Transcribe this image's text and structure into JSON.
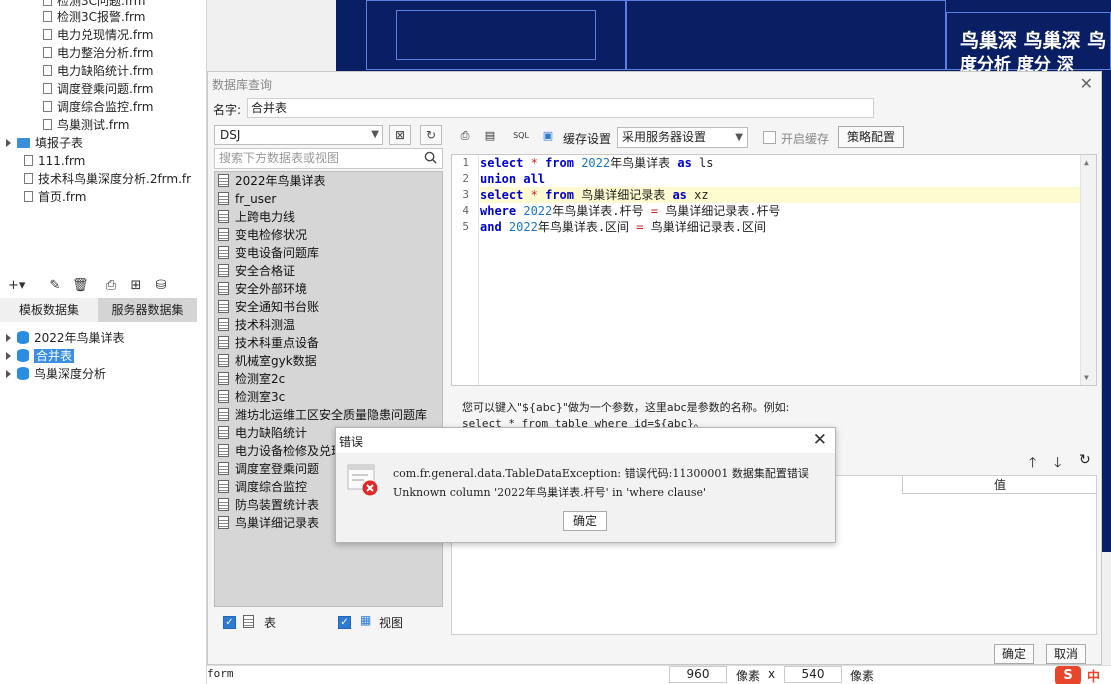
{
  "left_panel": {
    "file_items": [
      "检测3C问题.frm",
      "检测3C报警.frm",
      "电力兑现情况.frm",
      "电力整治分析.frm",
      "电力缺陷统计.frm",
      "调度登乘问题.frm",
      "调度综合监控.frm",
      "鸟巢测试.frm"
    ],
    "folder_item": "填报子表",
    "root_files": [
      "111.frm",
      "技术科鸟巢深度分析.2frm.fr",
      "首页.frm"
    ],
    "tabs": [
      "模板数据集",
      "服务器数据集"
    ],
    "datasets": [
      "2022年鸟巢详表",
      "合并表",
      "鸟巢深度分析"
    ]
  },
  "dashboard_bg": {
    "line1": "鸟巢深 鸟巢深 鸟",
    "line2": "度分析 度分 深"
  },
  "dialog": {
    "title": "数据库查询",
    "name_label": "名字:",
    "name_value": "合并表",
    "connection": "DSJ",
    "search_placeholder": "搜索下方数据表或视图",
    "tables": [
      "2022年鸟巢详表",
      "fr_user",
      "上跨电力线",
      "变电检修状况",
      "变电设备问题库",
      "安全合格证",
      "安全外部环境",
      "安全通知书台账",
      "技术科测温",
      "技术科重点设备",
      "机械室gyk数据",
      "检测室2c",
      "检测室3c",
      "潍坊北运维工区安全质量隐患问题库",
      "电力缺陷统计",
      "电力设备检修及兑现",
      "调度室登乘问题",
      "调度综合监控",
      "防鸟装置统计表",
      "鸟巢详细记录表"
    ],
    "footer_table_label": "表",
    "footer_view_label": "视图",
    "toolbar": {
      "cache_settings_label": "缓存设置",
      "cache_select_value": "采用服务器设置",
      "enable_cache_label": "开启缓存",
      "strategy_button": "策略配置"
    },
    "sql_lines": [
      "1",
      "2",
      "3",
      "4",
      "5"
    ],
    "sql": {
      "l1_pre": "select",
      "l1_star": "*",
      "l1_from": "from",
      "l1_num": "2022",
      "l1_tbl": "年鸟巢详表",
      "l1_as": "as",
      "l1_alias": "ls",
      "l2": "union all",
      "l3_pre": "select",
      "l3_star": "*",
      "l3_from": "from",
      "l3_tbl": "鸟巢详细记录表",
      "l3_as": "as",
      "l3_alias": "xz",
      "l4_where": "where",
      "l4_num": "2022",
      "l4_rest1": "年鸟巢详表.杆号",
      "l4_eq": "=",
      "l4_rest2": "鸟巢详细记录表.杆号",
      "l5_and": "and",
      "l5_num": "2022",
      "l5_rest1": "年鸟巢详表.区间",
      "l5_eq": "=",
      "l5_rest2": "鸟巢详细记录表.区间"
    },
    "hint_line1": "您可以键入\"${abc}\"做为一个参数，这里abc是参数的名称。例如:",
    "hint_line2": "select * from table where id=${abc}。",
    "param_value_header": "值",
    "ok_label": "确定",
    "cancel_label": "取消"
  },
  "error_modal": {
    "title": "错误",
    "message_line1": "com.fr.general.data.TableDataException: 错误代码:11300001 数据集配置错误",
    "message_line2": "Unknown column '2022年鸟巢详表.杆号' in 'where clause'",
    "ok_label": "确定"
  },
  "status_bar": {
    "unit_left": "form",
    "width_value": "960",
    "px_label": "像素",
    "times": "x",
    "height_value": "540",
    "px_label2": "像素",
    "ime": "中"
  }
}
